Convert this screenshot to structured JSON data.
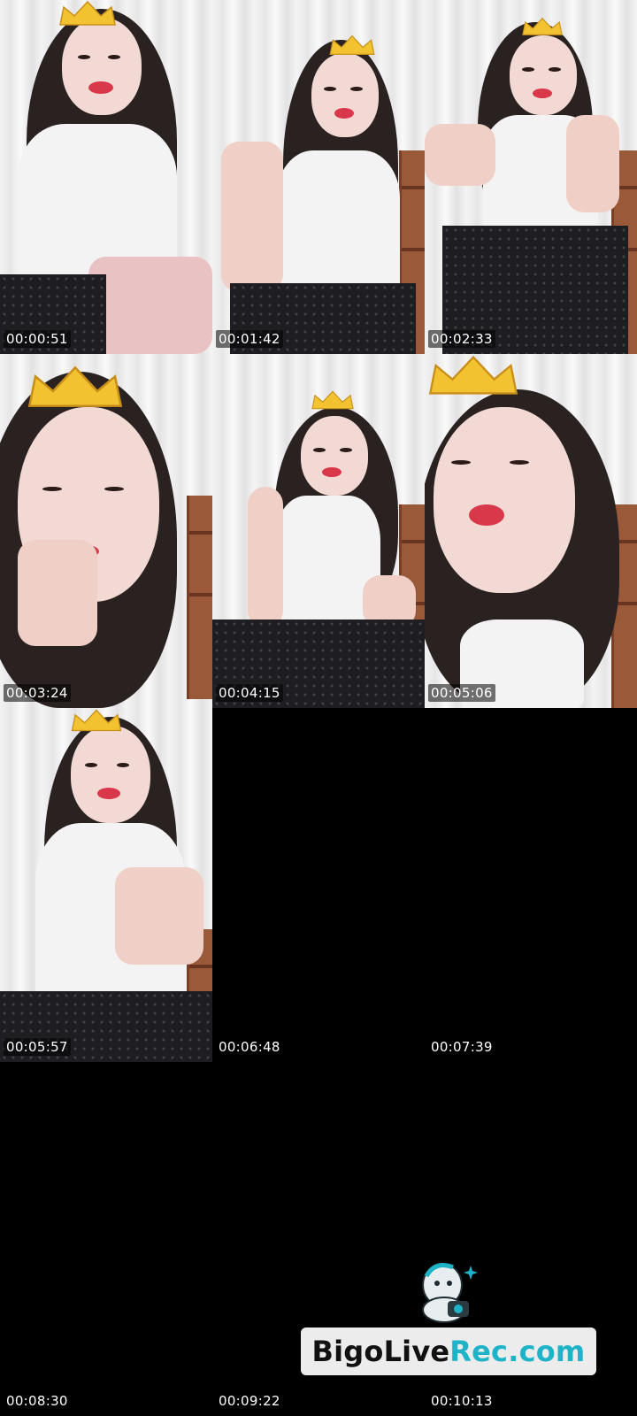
{
  "thumbnails": [
    {
      "timestamp": "00:00:51",
      "has_image": true
    },
    {
      "timestamp": "00:01:42",
      "has_image": true
    },
    {
      "timestamp": "00:02:33",
      "has_image": true
    },
    {
      "timestamp": "00:03:24",
      "has_image": true
    },
    {
      "timestamp": "00:04:15",
      "has_image": true
    },
    {
      "timestamp": "00:05:06",
      "has_image": true
    },
    {
      "timestamp": "00:05:57",
      "has_image": true
    },
    {
      "timestamp": "00:06:48",
      "has_image": false
    },
    {
      "timestamp": "00:07:39",
      "has_image": false
    },
    {
      "timestamp": "00:08:30",
      "has_image": false
    },
    {
      "timestamp": "00:09:22",
      "has_image": false
    },
    {
      "timestamp": "00:10:13",
      "has_image": false
    }
  ],
  "watermark": {
    "text_part1": "BigoLive",
    "text_part2": "Rec.com",
    "icon": "bigo-mascot-icon",
    "accent_color": "#1fb3c8"
  },
  "colors": {
    "background": "#000000",
    "timestamp_text": "#ffffff",
    "crown": "#f2c230"
  }
}
